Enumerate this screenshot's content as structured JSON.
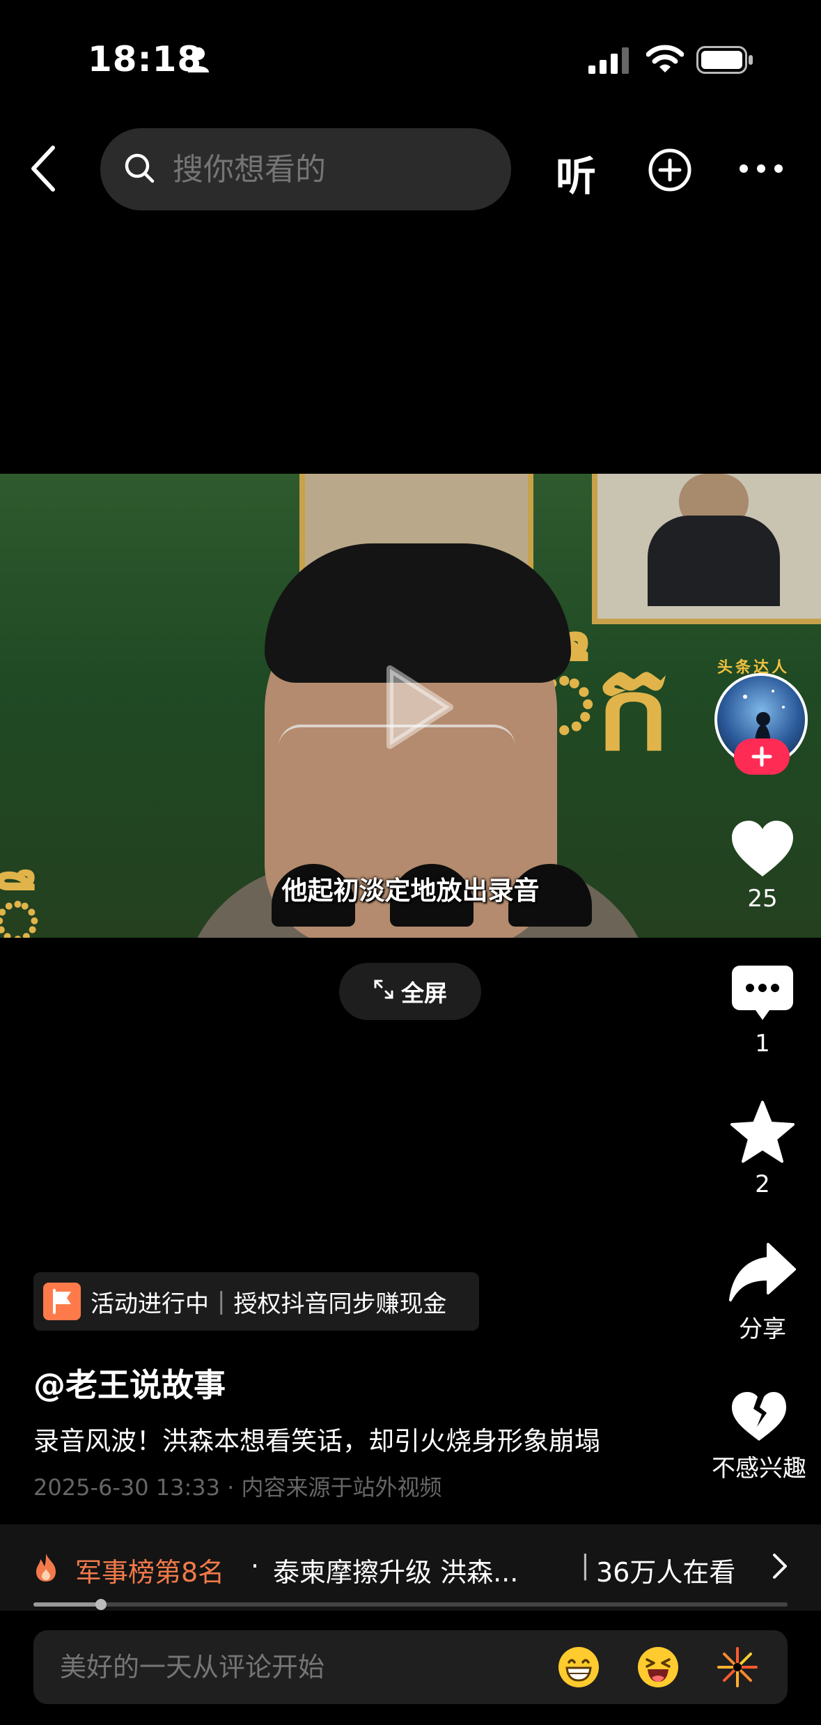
{
  "status_bar": {
    "time": "18:18"
  },
  "search": {
    "placeholder": "搜你想看的"
  },
  "top_actions": {
    "listen_label": "听"
  },
  "video": {
    "subtitle": "他起初淡定地放出录音",
    "progress": 0.09
  },
  "fullscreen": {
    "label": "全屏"
  },
  "rail": {
    "avatar_badge": "头条达人",
    "like_count": "25",
    "comment_count": "1",
    "favorite_count": "2",
    "share_label": "分享",
    "dislike_label": "不感兴趣"
  },
  "activity": {
    "status": "活动进行中",
    "text": "授权抖音同步赚现金"
  },
  "post": {
    "author": "@老王说故事",
    "title": "录音风波！洪森本想看笑话，却引火烧身形象崩塌",
    "date": "2025-6-30 13:33",
    "source": "内容来源于站外视频"
  },
  "hot_bar": {
    "rank": "军事榜第8名",
    "topic": "泰柬摩擦升级 洪森...",
    "viewers": "36万人在看"
  },
  "comment": {
    "placeholder": "美好的一天从评论开始"
  },
  "colors": {
    "accent": "#fe2c55",
    "hot": "#f27a4a",
    "background": "#000000"
  }
}
